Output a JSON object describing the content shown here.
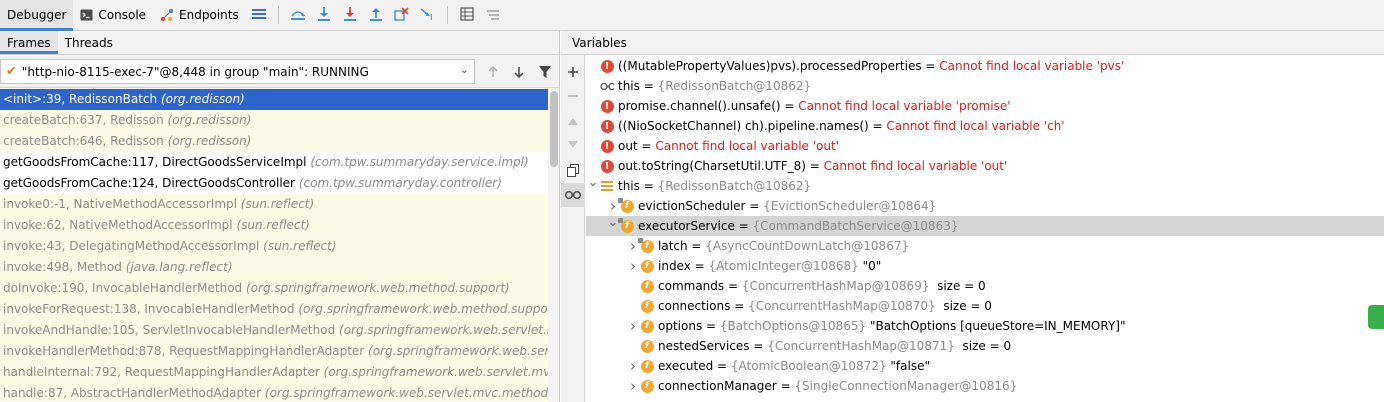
{
  "toolbar": {
    "tabs": [
      {
        "label": "Debugger",
        "active": true
      },
      {
        "label": "Console",
        "icon": "console-icon"
      },
      {
        "label": "Endpoints",
        "icon": "endpoints-icon"
      }
    ],
    "buttons": [
      "threads-menu-icon",
      "show-execution-point-icon",
      "step-over-icon",
      "step-into-icon",
      "force-step-into-icon",
      "step-out-icon",
      "drop-frame-icon",
      "run-to-cursor-icon",
      "evaluate-expression-icon",
      "trace-icon"
    ]
  },
  "left": {
    "tabs": [
      {
        "label": "Frames",
        "active": true
      },
      {
        "label": "Threads"
      }
    ],
    "thread_selector": "\"http-nio-8115-exec-7\"@8,448 in group \"main\": RUNNING",
    "frames": [
      {
        "method": "<init>:39, RedissonBatch",
        "pkg": "(org.redisson)",
        "kind": "selected"
      },
      {
        "method": "createBatch:637, Redisson",
        "pkg": "(org.redisson)",
        "kind": "lib"
      },
      {
        "method": "createBatch:646, Redisson",
        "pkg": "(org.redisson)",
        "kind": "lib"
      },
      {
        "method": "getGoodsFromCache:117, DirectGoodsServiceImpl",
        "pkg": "(com.tpw.summaryday.service.impl)",
        "kind": "project"
      },
      {
        "method": "getGoodsFromCache:124, DirectGoodsController",
        "pkg": "(com.tpw.summaryday.controller)",
        "kind": "project"
      },
      {
        "method": "invoke0:-1, NativeMethodAccessorImpl",
        "pkg": "(sun.reflect)",
        "kind": "lib"
      },
      {
        "method": "invoke:62, NativeMethodAccessorImpl",
        "pkg": "(sun.reflect)",
        "kind": "lib"
      },
      {
        "method": "invoke:43, DelegatingMethodAccessorImpl",
        "pkg": "(sun.reflect)",
        "kind": "lib"
      },
      {
        "method": "invoke:498, Method",
        "pkg": "(java.lang.reflect)",
        "kind": "lib"
      },
      {
        "method": "doInvoke:190, InvocableHandlerMethod",
        "pkg": "(org.springframework.web.method.support)",
        "kind": "lib"
      },
      {
        "method": "invokeForRequest:138, InvocableHandlerMethod",
        "pkg": "(org.springframework.web.method.support)",
        "kind": "lib"
      },
      {
        "method": "invokeAndHandle:105, ServletInvocableHandlerMethod",
        "pkg": "(org.springframework.web.servlet.mvc.m",
        "kind": "lib"
      },
      {
        "method": "invokeHandlerMethod:878, RequestMappingHandlerAdapter",
        "pkg": "(org.springframework.web.servlet.",
        "kind": "lib"
      },
      {
        "method": "handleInternal:792, RequestMappingHandlerAdapter",
        "pkg": "(org.springframework.web.servlet.mvc.me",
        "kind": "lib"
      },
      {
        "method": "handle:87, AbstractHandlerMethodAdapter",
        "pkg": "(org.springframework.web.servlet.mvc.method)",
        "kind": "lib"
      }
    ]
  },
  "right": {
    "title": "Variables",
    "vars": [
      {
        "depth": 0,
        "arrow": "",
        "icon": "error",
        "name": "((MutablePropertyValues)pvs).processedProperties",
        "eq": " = ",
        "value": "Cannot find local variable 'pvs'",
        "vclass": "err",
        "extra": ""
      },
      {
        "depth": 0,
        "arrow": "",
        "icon": "watch",
        "name": "this",
        "eq": " = ",
        "value": "{RedissonBatch@10862}",
        "vclass": "gray",
        "extra": ""
      },
      {
        "depth": 0,
        "arrow": "",
        "icon": "error",
        "name": "promise.channel().unsafe()",
        "eq": " = ",
        "value": "Cannot find local variable 'promise'",
        "vclass": "err",
        "extra": ""
      },
      {
        "depth": 0,
        "arrow": "",
        "icon": "error",
        "name": "((NioSocketChannel) ch).pipeline.names()",
        "eq": " = ",
        "value": "Cannot find local variable 'ch'",
        "vclass": "err",
        "extra": ""
      },
      {
        "depth": 0,
        "arrow": "",
        "icon": "error",
        "name": "out",
        "eq": " = ",
        "value": "Cannot find local variable 'out'",
        "vclass": "err",
        "extra": ""
      },
      {
        "depth": 0,
        "arrow": "",
        "icon": "error",
        "name": "out.toString(CharsetUtil.UTF_8)",
        "eq": " = ",
        "value": "Cannot find local variable 'out'",
        "vclass": "err",
        "extra": ""
      },
      {
        "depth": 0,
        "arrow": "down",
        "icon": "list",
        "name": "this",
        "eq": " = ",
        "value": "{RedissonBatch@10862}",
        "vclass": "gray",
        "extra": ""
      },
      {
        "depth": 1,
        "arrow": "right",
        "icon": "field-lock",
        "name": "evictionScheduler",
        "eq": " = ",
        "value": "{EvictionScheduler@10864}",
        "vclass": "gray",
        "extra": ""
      },
      {
        "depth": 1,
        "arrow": "down",
        "icon": "field-lock",
        "name": "executorService",
        "eq": " = ",
        "value": "{CommandBatchService@10863}",
        "vclass": "gray",
        "extra": "",
        "selected": true
      },
      {
        "depth": 2,
        "arrow": "right",
        "icon": "field-lock",
        "name": "latch",
        "eq": " = ",
        "value": "{AsyncCountDownLatch@10867}",
        "vclass": "gray",
        "extra": ""
      },
      {
        "depth": 2,
        "arrow": "right",
        "icon": "field",
        "name": "index",
        "eq": " = ",
        "value": "{AtomicInteger@10868}",
        "vclass": "gray",
        "extra": " \"0\""
      },
      {
        "depth": 2,
        "arrow": "",
        "icon": "field",
        "name": "commands",
        "eq": " = ",
        "value": "{ConcurrentHashMap@10869}",
        "vclass": "gray",
        "extra": "  size = 0"
      },
      {
        "depth": 2,
        "arrow": "",
        "icon": "field",
        "name": "connections",
        "eq": " = ",
        "value": "{ConcurrentHashMap@10870}",
        "vclass": "gray",
        "extra": "  size = 0"
      },
      {
        "depth": 2,
        "arrow": "right",
        "icon": "field",
        "name": "options",
        "eq": " = ",
        "value": "{BatchOptions@10865}",
        "vclass": "gray",
        "extra": " \"BatchOptions [queueStore=IN_MEMORY]\""
      },
      {
        "depth": 2,
        "arrow": "",
        "icon": "field",
        "name": "nestedServices",
        "eq": " = ",
        "value": "{ConcurrentHashMap@10871}",
        "vclass": "gray",
        "extra": "  size = 0"
      },
      {
        "depth": 2,
        "arrow": "right",
        "icon": "field",
        "name": "executed",
        "eq": " = ",
        "value": "{AtomicBoolean@10872}",
        "vclass": "gray",
        "extra": " \"false\""
      },
      {
        "depth": 2,
        "arrow": "right",
        "icon": "field",
        "name": "connectionManager",
        "eq": " = ",
        "value": "{SingleConnectionManager@10816}",
        "vclass": "gray",
        "extra": ""
      }
    ]
  },
  "colors": {
    "accent": "#4083c9",
    "selected_frame": "#2f65ca",
    "error": "#d21f1f",
    "library_bg": "#fcfce6",
    "field_icon": "#f0a732"
  }
}
